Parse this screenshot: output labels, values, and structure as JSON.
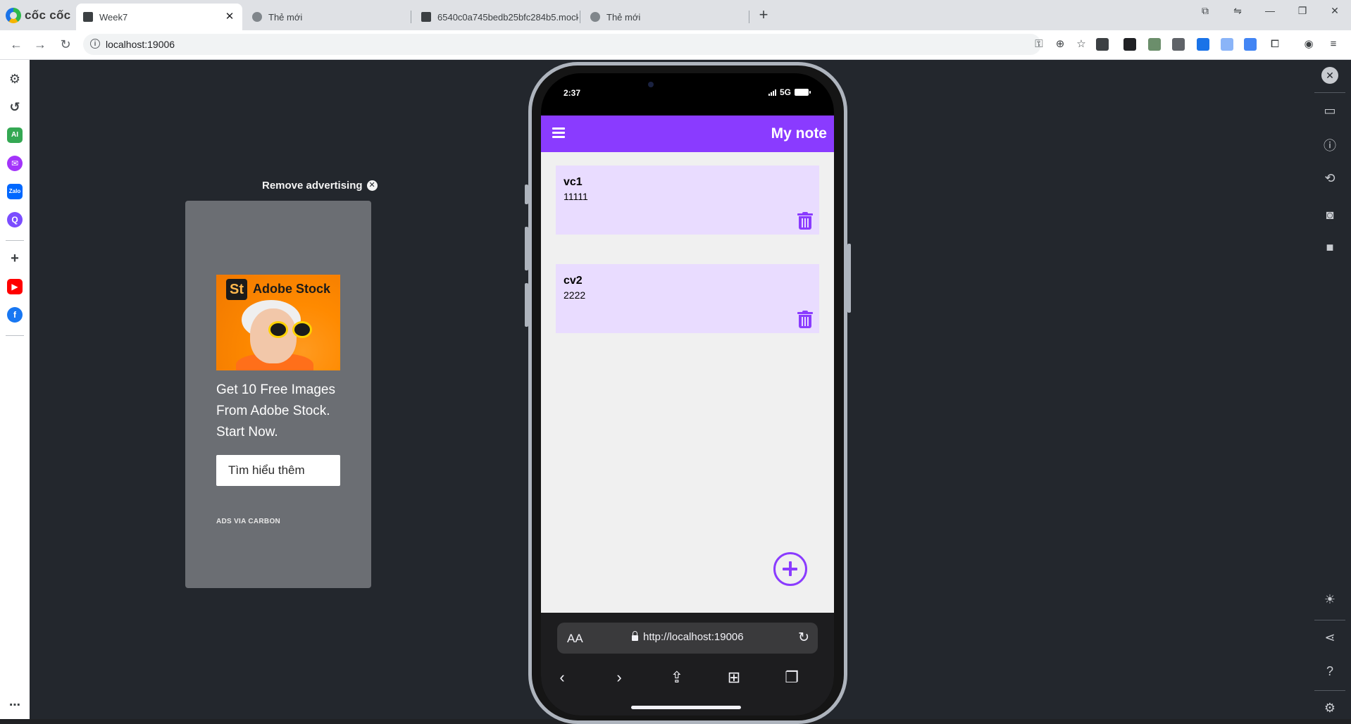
{
  "browser": {
    "brand": "cốc cốc",
    "tabs": [
      {
        "title": "Week7",
        "active": true
      },
      {
        "title": "Thẻ mới",
        "active": false
      },
      {
        "title": "6540c0a745bedb25bfc284b5.mockap",
        "active": false
      },
      {
        "title": "Thẻ mới",
        "active": false
      }
    ],
    "address": "localhost:19006",
    "icons": [
      "key-icon",
      "zoom-icon",
      "star-icon",
      "shield-icon",
      "extension-icon",
      "profile-icon",
      "menu-icon"
    ]
  },
  "ad": {
    "remove_label": "Remove advertising",
    "image_badge": "St",
    "image_brand": "Adobe Stock",
    "text": "Get 10 Free Images From Adobe Stock. Start Now.",
    "button": "Tìm hiểu thêm",
    "via": "ADS VIA CARBON"
  },
  "phone": {
    "time": "2:37",
    "network": "5G",
    "app_title": "My note",
    "notes": [
      {
        "title": "vc1",
        "content": "11111"
      },
      {
        "title": "cv2",
        "content": "2222"
      }
    ],
    "safari": {
      "aa": "AA",
      "url": "http://localhost:19006"
    }
  },
  "colors": {
    "accent": "#8a3bff",
    "note_bg": "#e9dcff",
    "page_bg": "#23272d"
  }
}
